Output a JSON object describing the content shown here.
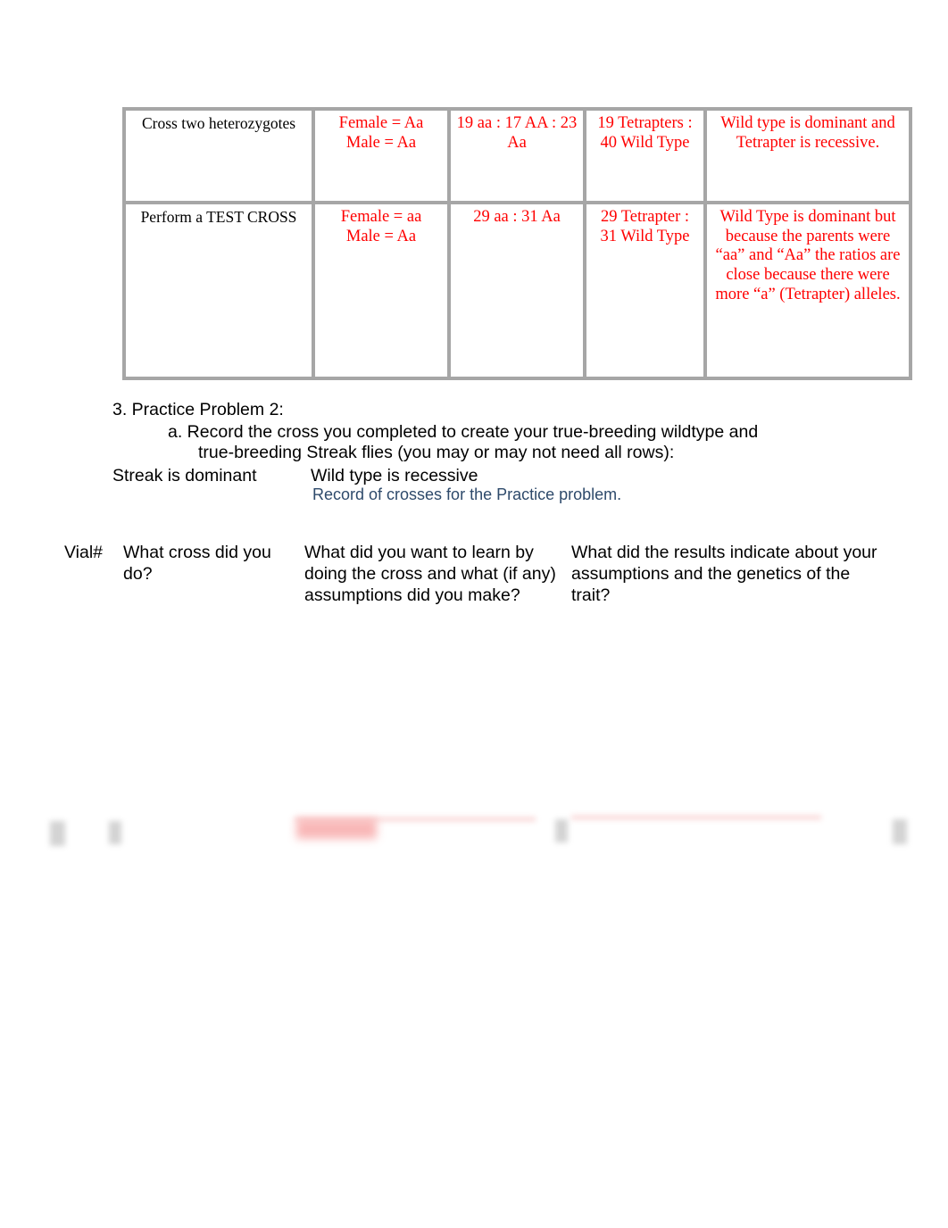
{
  "document": {
    "title": "Genetics Lab Worksheet - Practice Problem 2"
  },
  "cross_table": {
    "rows": [
      {
        "cross_label": "Cross two heterozygotes",
        "parents": "Female = Aa\nMale = Aa",
        "genotype_ratio": "19 aa : 17 AA : 23 Aa",
        "phenotype_ratio": "19 Tetrapters : 40 Wild Type",
        "conclusion": "Wild type is dominant and Tetrapter is recessive."
      },
      {
        "cross_label": "Perform a TEST CROSS",
        "parents": "Female = aa\nMale = Aa",
        "genotype_ratio": "29 aa : 31 Aa",
        "phenotype_ratio": "29 Tetrapter : 31 Wild Type",
        "conclusion": "Wild Type is dominant but because the parents were “aa” and “Aa” the ratios are close because there were more “a” (Tetrapter) alleles."
      }
    ]
  },
  "practice_problem": {
    "heading": "3. Practice Problem 2:",
    "item_a_line1": "a. Record the cross you completed to create your true-breeding wildtype and",
    "item_a_line2": "true-breeding Streak flies (you may or may not need all rows):",
    "streak_note": "Streak is dominant",
    "wildtype_note": "Wild type is recessive",
    "caption": "Record of crosses for the Practice problem."
  },
  "record_table_headers": {
    "vial": "Vial#",
    "cross": "What cross did you do?",
    "learn": "What did you want to learn by doing the cross and what (if any) assumptions did you make?",
    "results": "What did the results indicate about your assumptions and the genetics of the trait?"
  },
  "colors": {
    "answer_red": "#ff0000",
    "caption_blue": "#2e4a6b",
    "table_border_gray": "#a6a6a6",
    "body_text": "#000000"
  }
}
